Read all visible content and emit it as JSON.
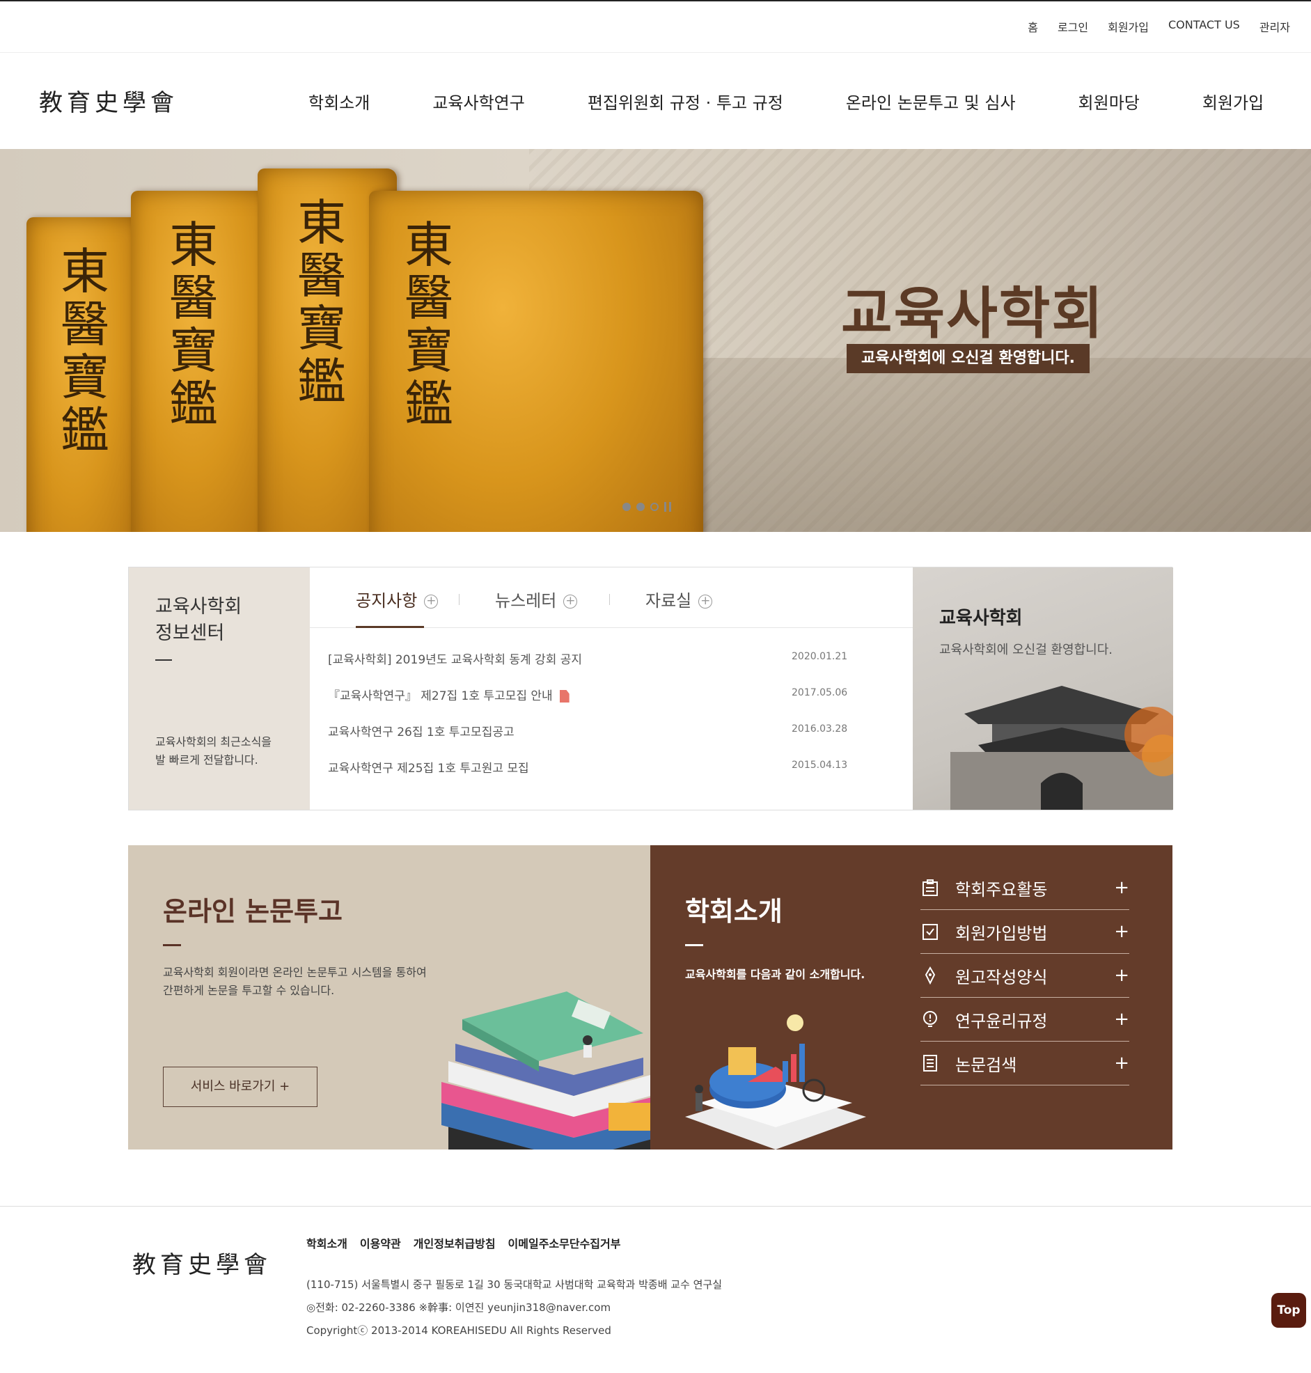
{
  "util_nav": [
    "홈",
    "로그인",
    "회원가입",
    "CONTACT US",
    "관리자"
  ],
  "logo": "教育史學會",
  "gnb": [
    "학회소개",
    "교육사학연구",
    "편집위원회 규정 · 투고 규정",
    "온라인 논문투고 및 심사",
    "회원마당",
    "회원가입"
  ],
  "hero": {
    "title": "교육사학회",
    "subtitle": "교육사학회에 오신걸 환영합니다.",
    "book_text": [
      "東醫寶鑑",
      "東醫寶鑑",
      "東醫寶鑑",
      "東醫寶鑑"
    ]
  },
  "info": {
    "title_line1": "교육사학회",
    "title_line2": "정보센터",
    "desc_line1": "교육사학회의 최근소식을",
    "desc_line2": "발 빠르게 전달합니다.",
    "tabs": [
      "공지사항",
      "뉴스레터",
      "자료실"
    ],
    "tab_plus": "+",
    "notices": [
      {
        "title": "[교육사학회] 2019년도 교육사학회 동계 강회 공지",
        "date": "2020.01.21"
      },
      {
        "title": "『교육사학연구』 제27집 1호 투고모집 안내",
        "date": "2017.05.06"
      },
      {
        "title": "교육사학연구 26집 1호 투고모집공고",
        "date": "2016.03.28"
      },
      {
        "title": "교육사학연구 제25집 1호 투고원고 모집",
        "date": "2015.04.13"
      }
    ],
    "right_title": "교육사학회",
    "right_desc": "교육사학회에 오신걸 환영합니다."
  },
  "online": {
    "title": "온라인 논문투고",
    "desc_line1": "교육사학회 회원이라면 온라인 논문투고 시스템을 통하여",
    "desc_line2": "간편하게 논문을 투고할 수 있습니다.",
    "button": "서비스 바로가기 +"
  },
  "intro": {
    "title": "학회소개",
    "desc": "교육사학회를 다음과 같이 소개합니다.",
    "links": [
      "학회주요활동",
      "회원가입방법",
      "원고작성양식",
      "연구윤리규정",
      "논문검색"
    ],
    "plus": "+"
  },
  "footer": {
    "logo": "教育史學會",
    "nav": [
      "학회소개",
      "이용약관",
      "개인정보취급방침",
      "이메일주소무단수집거부"
    ],
    "address": "(110-715) 서울특별시 중구 필동로 1길 30 동국대학교 사범대학 교육학과 박종배 교수 연구실",
    "contact": "◎전화: 02-2260-3386 ※幹事: 이연진 yeunjin318@naver.com",
    "copyright": "Copyrightⓒ 2013-2014 KOREAHISEDU All Rights Reserved"
  },
  "top_button": "Top",
  "colors": {
    "brown_dark": "#643c2a",
    "beige": "#d4c9b8",
    "hero_label_bg": "#5a3a27"
  }
}
